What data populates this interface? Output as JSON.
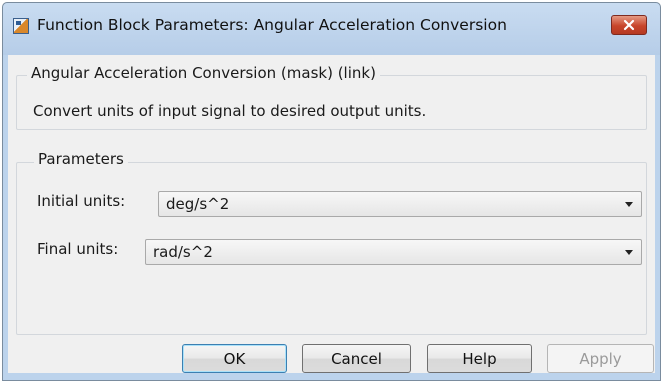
{
  "window": {
    "title": "Function Block Parameters: Angular Acceleration Conversion",
    "close_icon": "close-x-icon",
    "app_icon": "simulink-block-icon"
  },
  "description_group": {
    "title": "Angular Acceleration Conversion (mask) (link)",
    "text": "Convert units of input signal to desired output units."
  },
  "parameters_group": {
    "title": "Parameters",
    "initial_units": {
      "label": "Initial units:",
      "value": "deg/s^2"
    },
    "final_units": {
      "label": "Final units:",
      "value": "rad/s^2"
    }
  },
  "buttons": {
    "ok": "OK",
    "cancel": "Cancel",
    "help": "Help",
    "apply": "Apply"
  }
}
